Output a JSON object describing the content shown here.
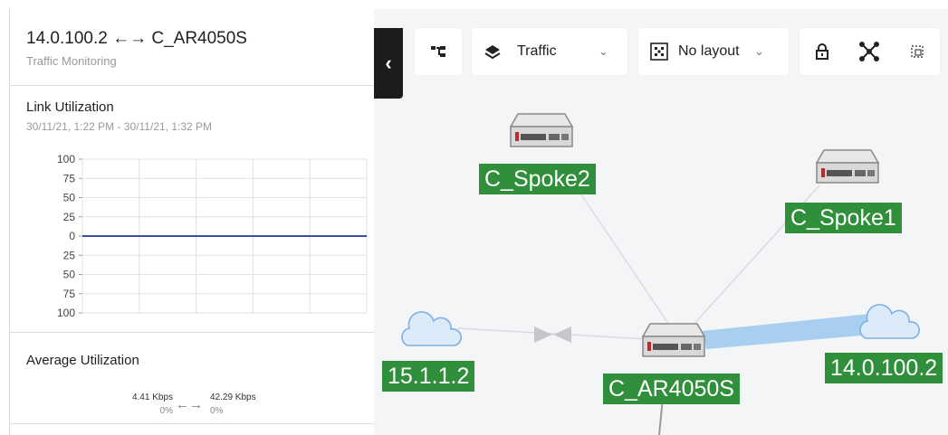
{
  "panel": {
    "title": "14.0.100.2 ←→ C_AR4050S",
    "subtitle": "Traffic Monitoring"
  },
  "link_utilization": {
    "title": "Link Utilization",
    "range": "30/11/21, 1:22 PM - 30/11/21, 1:32 PM"
  },
  "chart_data": {
    "type": "line",
    "title": "Link Utilization",
    "y_ticks": [
      "100",
      "75",
      "50",
      "25",
      "0",
      "25",
      "50",
      "75",
      "100"
    ],
    "ylim": [
      -100,
      100
    ],
    "grid": true,
    "series": [
      {
        "values": [
          0,
          0,
          0,
          0,
          0,
          0
        ],
        "color": "#3a4fa0"
      }
    ]
  },
  "average": {
    "title": "Average Utilization",
    "left_value": "4.41 Kbps",
    "left_pct": "0%",
    "arrow": "←→",
    "right_value": "42.29 Kbps",
    "right_pct": "0%"
  },
  "toolbar": {
    "collapse_glyph": "‹",
    "view_select": {
      "icon": "layers-icon",
      "value": "Traffic"
    },
    "layout_select": {
      "icon": "layout-icon",
      "value": "No layout"
    },
    "icons": [
      "hierarchy-icon",
      "lock-icon",
      "network-icon",
      "select-icon"
    ]
  },
  "nodes": {
    "spoke2": "C_Spoke2",
    "spoke1": "C_Spoke1",
    "cloud_left": "15.1.1.2",
    "ar4050s": "C_AR4050S",
    "cloud_right": "14.0.100.2"
  },
  "colors": {
    "node_label_bg": "#2f8f3a",
    "highlight_link": "#a8cff0",
    "series": "#3a4fa0"
  }
}
